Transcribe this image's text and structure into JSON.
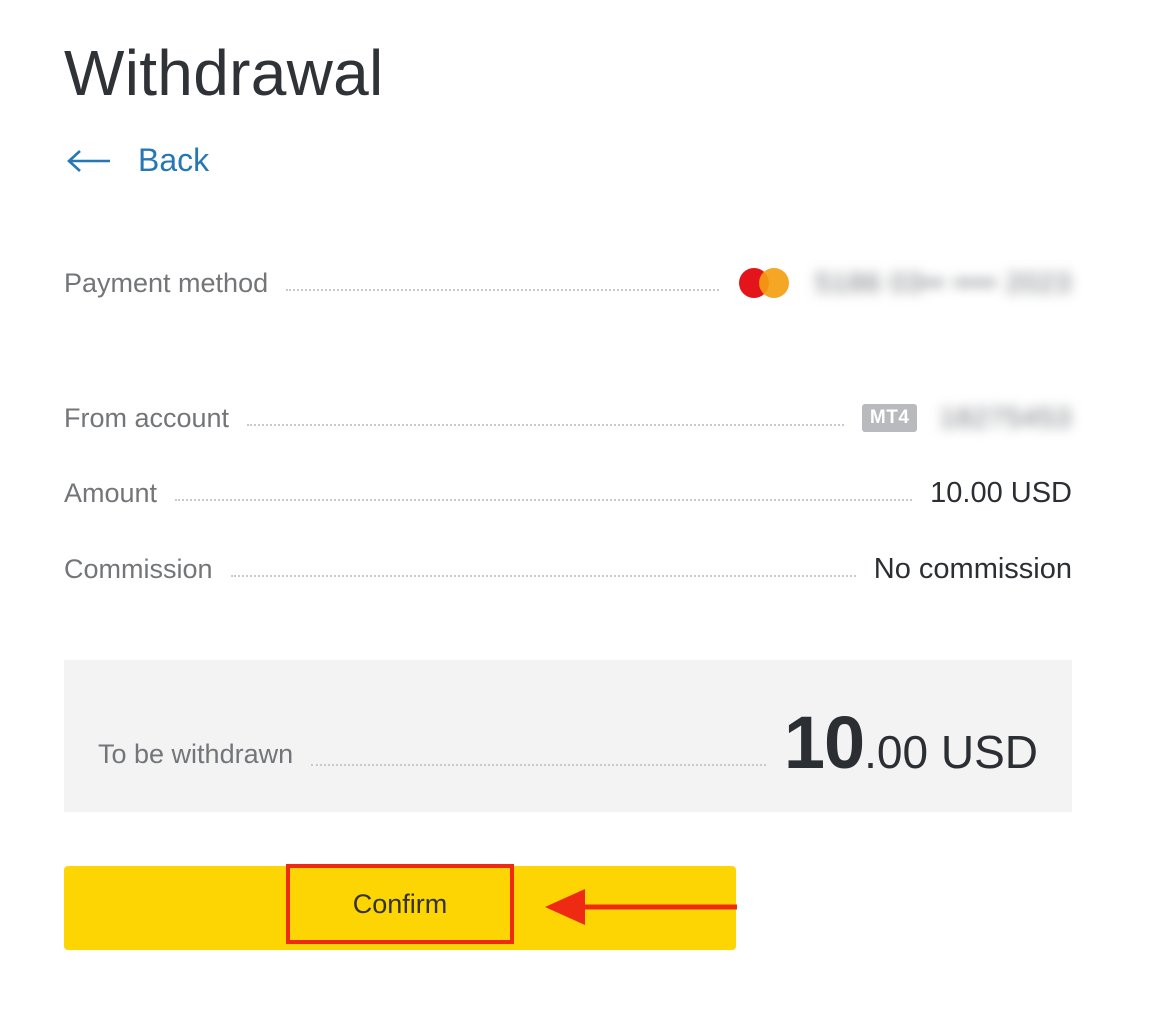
{
  "page": {
    "title": "Withdrawal",
    "back_label": "Back"
  },
  "details": {
    "payment_method": {
      "label": "Payment method",
      "card_brand_icon": "mastercard-icon",
      "card_number_blurred": "5186 03•• •••• 2023"
    },
    "from_account": {
      "label": "From account",
      "platform_badge": "MT4",
      "account_number_blurred": "18275453"
    },
    "amount": {
      "label": "Amount",
      "value": "10.00 USD"
    },
    "commission": {
      "label": "Commission",
      "value": "No commission"
    }
  },
  "summary": {
    "label": "To be withdrawn",
    "amount_whole": "10",
    "amount_fraction": ".00 USD"
  },
  "actions": {
    "confirm_label": "Confirm"
  },
  "colors": {
    "accent_yellow": "#fcd502",
    "link_blue": "#2678b4",
    "highlight_red": "#ef2a12"
  }
}
